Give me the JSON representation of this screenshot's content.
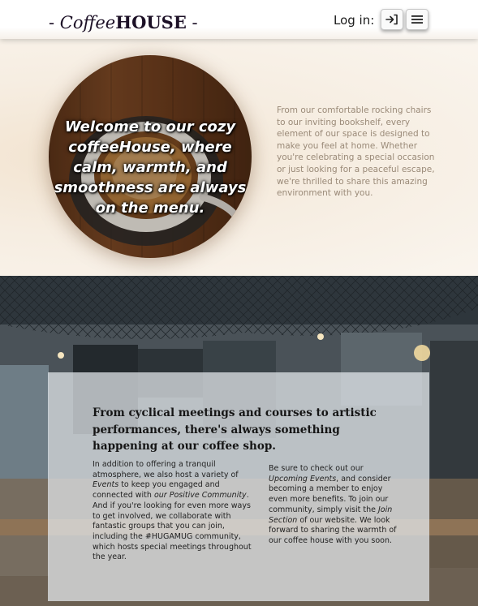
{
  "header": {
    "logo_prefix": "- ",
    "logo_coffee": "Coffee",
    "logo_house": "HOUSE",
    "logo_suffix": " -",
    "login_label": "Log in:",
    "login_icon": "sign-in-icon",
    "menu_icon": "hamburger-menu-icon"
  },
  "hero": {
    "welcome": "Welcome to our cozy coffeeHouse, where calm, warmth, and smoothness are always on the menu.",
    "description": "From our comfortable rocking chairs to our inviting bookshelf, every element of our space is designed to make you feel at home. Whether you're celebrating a special occasion or just looking for a peaceful escape, we're thrilled to share this amazing environment with you."
  },
  "events": {
    "title": "From cyclical meetings and courses to artistic performances, there's always something happening at our coffee shop.",
    "left_1": "In addition to offering a tranquil atmosphere, we also host a variety of ",
    "left_link_events": "Events",
    "left_2": " to keep you engaged and connected with ",
    "left_link_community": "our Positive Community",
    "left_3": ". And if you're looking for even more ways to get involved, we collaborate with fantastic groups that you can join, including the #HUGAMUG community, which hosts special meetings throughout the year.",
    "right_1": "Be sure to check out our ",
    "right_link_upcoming": "Upcoming Events",
    "right_2": ", and consider becoming a member to enjoy even more benefits. To join our community, simply visit the ",
    "right_link_join": "Join Section",
    "right_3": " of our website. We look forward to sharing the warmth of our coffee house with you soon."
  },
  "colors": {
    "logo": "#1c1026",
    "hero_text": "#9a8a78",
    "panel": "#e8ecf0"
  }
}
